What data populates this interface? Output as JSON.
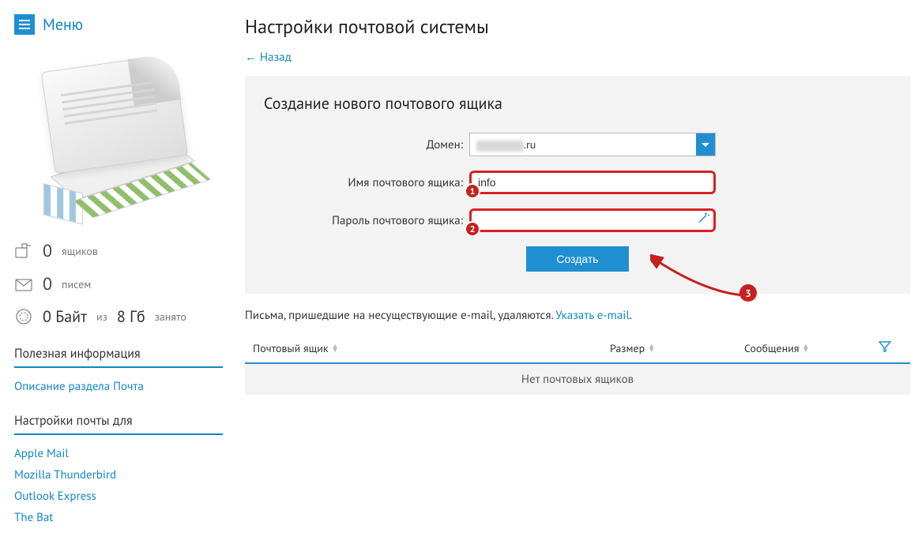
{
  "menu": {
    "label": "Меню"
  },
  "sidebar": {
    "stats": {
      "mailboxes": {
        "value": "0",
        "label": "ящиков"
      },
      "letters": {
        "value": "0",
        "label": "писем"
      },
      "storage_used": "0 Байт",
      "storage_of": "из",
      "storage_total": "8 Гб",
      "storage_suffix": "занято"
    },
    "section_useful": "Полезная информация",
    "link_description": "Описание раздела Почта",
    "section_clients": "Настройки почты для",
    "clients": [
      "Apple Mail",
      "Mozilla Thunderbird",
      "Outlook Express",
      "The Bat"
    ]
  },
  "main": {
    "title": "Настройки почтовой системы",
    "back": "← Назад",
    "panel_title": "Создание нового почтового ящика",
    "labels": {
      "domain": "Домен:",
      "mailbox_name": "Имя почтового ящика:",
      "mailbox_password": "Пароль почтового ящика:"
    },
    "domain_suffix": ".ru",
    "mailbox_name_value": "info",
    "mailbox_password_value": "",
    "submit": "Создать",
    "callouts": {
      "one": "1",
      "two": "2",
      "three": "3"
    },
    "notice_text": "Письма, пришедшие на несуществующие e-mail, удаляются. ",
    "notice_link": "Указать e-mail",
    "table": {
      "col_mailbox": "Почтовый ящик",
      "col_size": "Размер",
      "col_messages": "Сообщения",
      "empty": "Нет почтовых ящиков"
    }
  }
}
